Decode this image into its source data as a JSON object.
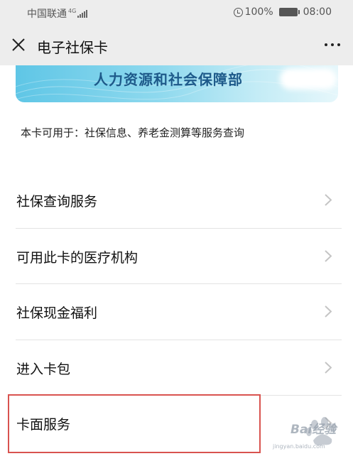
{
  "status_bar": {
    "carrier": "中国联通",
    "network": "4G",
    "battery": "100%",
    "time": "08:00"
  },
  "nav": {
    "title": "电子社保卡"
  },
  "card": {
    "issuer": "人力资源和社会保障部",
    "usage_text": "本卡可用于：社保信息、养老金测算等服务查询"
  },
  "menu": {
    "items": [
      {
        "label": "社保查询服务"
      },
      {
        "label": "可用此卡的医疗机构"
      },
      {
        "label": "社保现金福利"
      },
      {
        "label": "进入卡包"
      },
      {
        "label": "卡面服务"
      }
    ]
  },
  "watermark": {
    "text": "Bai经验",
    "sub": "jingyan.baidu.com"
  },
  "colors": {
    "highlight_border": "#d9534f",
    "bar_background": "#ededed",
    "card_gradient_start": "#5fc6e6"
  }
}
